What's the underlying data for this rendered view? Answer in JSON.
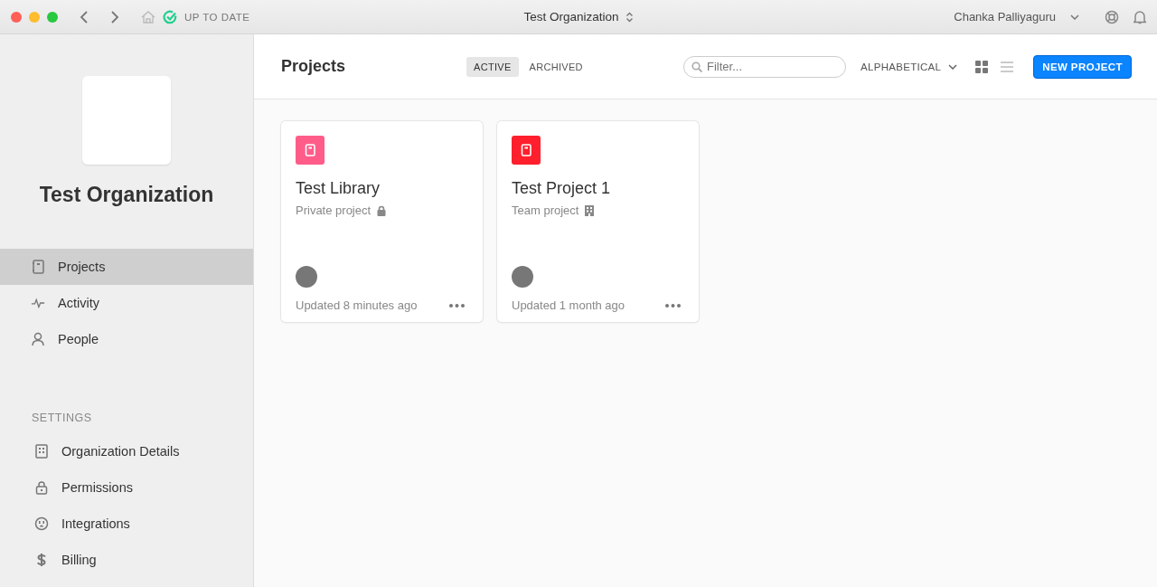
{
  "titlebar": {
    "sync_status": "UP TO DATE",
    "title": "Test Organization",
    "user": "Chanka Palliyaguru"
  },
  "sidebar": {
    "org_name": "Test Organization",
    "items": [
      {
        "label": "Projects",
        "kind": "notebook",
        "selected": true
      },
      {
        "label": "Activity",
        "kind": "pulse",
        "selected": false
      },
      {
        "label": "People",
        "kind": "person",
        "selected": false
      }
    ],
    "settings_heading": "SETTINGS",
    "settings": [
      {
        "label": "Organization Details",
        "kind": "building",
        "selected": false
      },
      {
        "label": "Permissions",
        "kind": "lock",
        "selected": false
      },
      {
        "label": "Integrations",
        "kind": "plug",
        "selected": false
      },
      {
        "label": "Billing",
        "kind": "dollar",
        "selected": false
      }
    ]
  },
  "header": {
    "title": "Projects",
    "tabs": [
      {
        "label": "ACTIVE",
        "selected": true
      },
      {
        "label": "ARCHIVED",
        "selected": false
      }
    ],
    "filter": {
      "placeholder": "Filter..."
    },
    "sort": "ALPHABETICAL",
    "views": [
      {
        "kind": "grid",
        "selected": true
      },
      {
        "kind": "list",
        "selected": false
      }
    ],
    "new_button": "NEW PROJECT"
  },
  "projects": [
    {
      "name": "Test Library",
      "visibility": "Private project",
      "kind": "private",
      "color": "#ff5c8a",
      "updated": "Updated 8 minutes ago"
    },
    {
      "name": "Test Project 1",
      "visibility": "Team project",
      "kind": "team",
      "color": "#ff1f2d",
      "updated": "Updated 1 month ago"
    }
  ]
}
